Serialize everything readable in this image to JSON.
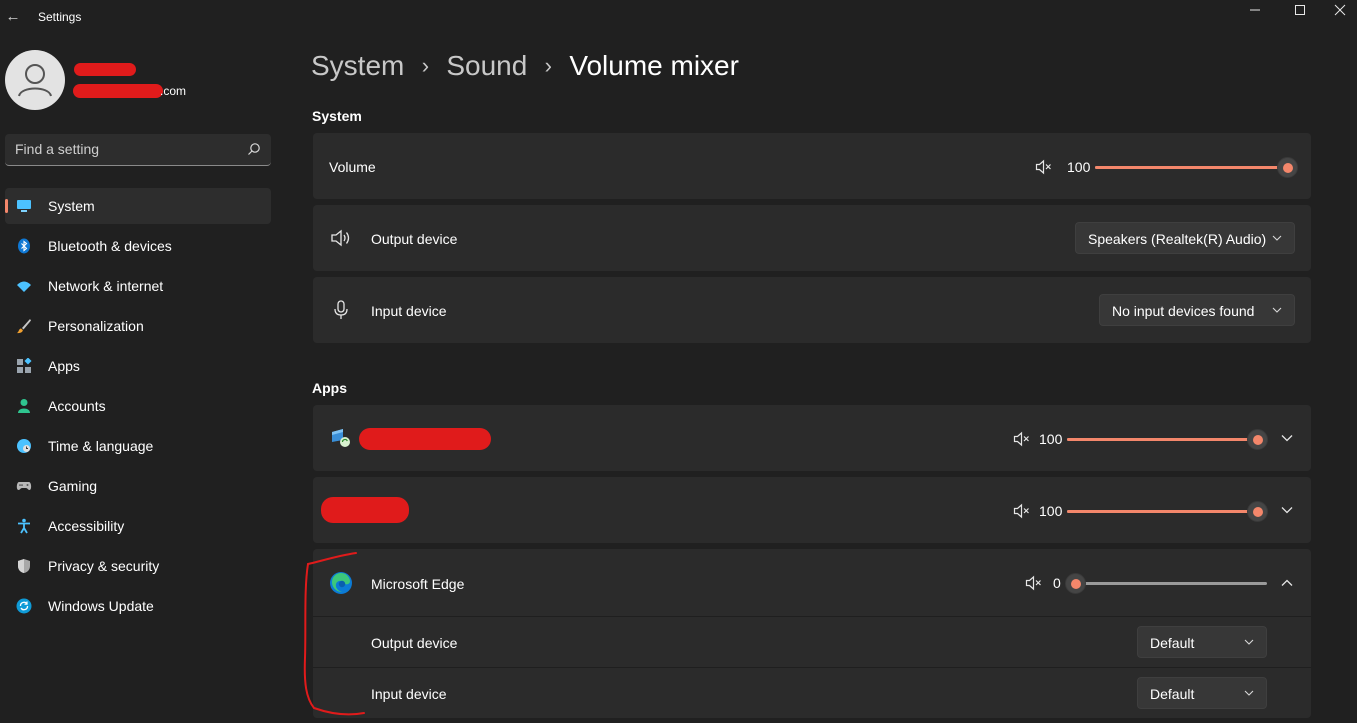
{
  "window": {
    "title": "Settings"
  },
  "profile": {
    "email_suffix": ".com"
  },
  "search": {
    "placeholder": "Find a setting"
  },
  "sidebar": {
    "items": [
      {
        "label": "System",
        "icon": "monitor-icon",
        "active": true
      },
      {
        "label": "Bluetooth & devices",
        "icon": "bluetooth-icon"
      },
      {
        "label": "Network & internet",
        "icon": "wifi-icon"
      },
      {
        "label": "Personalization",
        "icon": "brush-icon"
      },
      {
        "label": "Apps",
        "icon": "apps-icon"
      },
      {
        "label": "Accounts",
        "icon": "person-icon"
      },
      {
        "label": "Time & language",
        "icon": "globe-clock-icon"
      },
      {
        "label": "Gaming",
        "icon": "gamepad-icon"
      },
      {
        "label": "Accessibility",
        "icon": "accessibility-icon"
      },
      {
        "label": "Privacy & security",
        "icon": "shield-icon"
      },
      {
        "label": "Windows Update",
        "icon": "update-icon"
      }
    ]
  },
  "breadcrumb": {
    "items": [
      "System",
      "Sound",
      "Volume mixer"
    ],
    "separator": "›"
  },
  "system_section": {
    "heading": "System",
    "volume": {
      "label": "Volume",
      "value": "100",
      "level": 1.0
    },
    "output_device": {
      "label": "Output device",
      "selected": "Speakers (Realtek(R) Audio)"
    },
    "input_device": {
      "label": "Input device",
      "selected": "No input devices found"
    }
  },
  "apps_section": {
    "heading": "Apps",
    "apps": [
      {
        "volume": "100",
        "level": 1.0
      },
      {
        "volume": "100",
        "level": 1.0
      },
      {
        "name": "Microsoft Edge",
        "volume": "0",
        "level": 0.0,
        "output_label": "Output device",
        "output_selected": "Default",
        "input_label": "Input device",
        "input_selected": "Default"
      }
    ]
  },
  "colors": {
    "accent": "#f4876b",
    "annotation": "#e01b1b",
    "background": "#202020",
    "card": "#2b2b2b"
  }
}
